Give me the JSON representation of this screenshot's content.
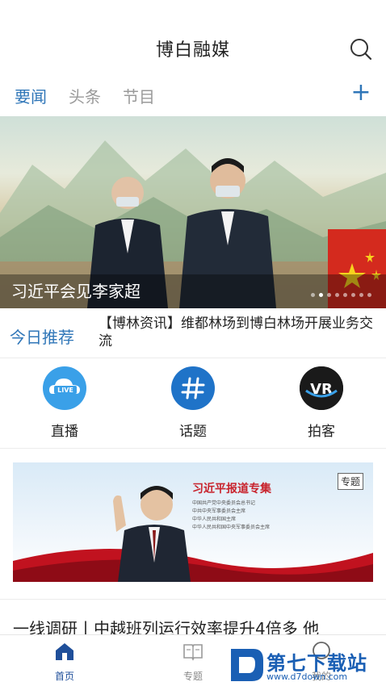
{
  "header": {
    "title": "博白融媒",
    "search_icon": "search-icon"
  },
  "tabs": {
    "items": [
      "要闻",
      "头条",
      "节目"
    ],
    "active": 0,
    "add_icon": "plus-icon"
  },
  "banner": {
    "caption": "习近平会见李家超",
    "slide_count": 8,
    "active_slide": 1
  },
  "recommend": {
    "label": "今日推荐",
    "text": "【博林资讯】维都林场到博白林场开展业务交流"
  },
  "quick_links": [
    {
      "label": "直播",
      "icon": "live-cloud-icon",
      "badge": "LIVE",
      "color": "#3aa0e8"
    },
    {
      "label": "话题",
      "icon": "hashtag-icon",
      "color": "#1f73c8"
    },
    {
      "label": "拍客",
      "icon": "vr-camera-icon",
      "badge": "VR",
      "color": "#1a1a1a"
    }
  ],
  "promo": {
    "title": "习近平报道专集",
    "lines": [
      "中国共产党中央委员会总书记",
      "中共中央军事委员会主席",
      "中华人民共和国主席",
      "中华人民共和国中央军事委员会主席"
    ],
    "tag": "专题"
  },
  "news": {
    "title": "一线调研丨中越班列运行效率提升4倍多 他"
  },
  "bottom_nav": [
    {
      "label": "首页",
      "icon": "home-icon",
      "active": true
    },
    {
      "label": "专题",
      "icon": "book-icon",
      "active": false
    },
    {
      "label": "我的",
      "icon": "user-icon",
      "active": false
    }
  ],
  "watermark": {
    "main": "第七下载站",
    "sub": "www.d7down.com",
    "logo_letter": "D"
  },
  "colors": {
    "accent": "#2f76b8",
    "nav_active": "#1f4f9a",
    "flag_red": "#d42a1e"
  }
}
